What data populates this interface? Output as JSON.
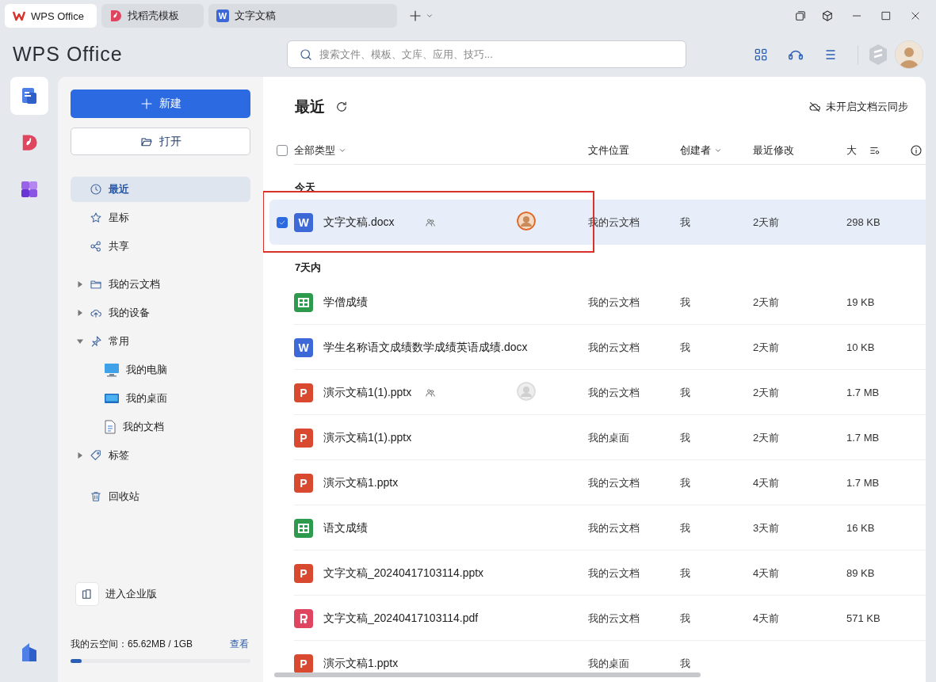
{
  "tabs": [
    {
      "label": "WPS Office",
      "kind": "wps",
      "selected": true
    },
    {
      "label": "找稻壳模板",
      "kind": "docer",
      "selected": false
    },
    {
      "label": "文字文稿",
      "kind": "word",
      "badge": "W",
      "selected": false
    }
  ],
  "header": {
    "brand": "WPS Office",
    "search": {
      "placeholder": "搜索文件、模板、文库、应用、技巧..."
    }
  },
  "rail": [
    {
      "kind": "docs",
      "selected": true
    },
    {
      "kind": "docer",
      "selected": false
    },
    {
      "kind": "apps",
      "selected": false
    }
  ],
  "sidebar": {
    "new_button": "新建",
    "open_button": "打开",
    "nav": [
      {
        "label": "最近",
        "selected": true
      },
      {
        "label": "星标",
        "selected": false
      },
      {
        "label": "共享",
        "selected": false
      }
    ],
    "tree": [
      {
        "label": "我的云文档",
        "expanded": false
      },
      {
        "label": "我的设备",
        "expanded": false
      },
      {
        "label": "常用",
        "expanded": true,
        "children": [
          {
            "label": "我的电脑"
          },
          {
            "label": "我的桌面"
          },
          {
            "label": "我的文档"
          }
        ]
      },
      {
        "label": "标签",
        "expanded": false
      }
    ],
    "trash": "回收站",
    "enterprise": "进入企业版",
    "storage": {
      "label": "我的云空间：65.62MB / 1GB",
      "link": "查看",
      "level": 0.06
    }
  },
  "main": {
    "title": "最近",
    "sync_status": "未开启文档云同步",
    "select_all": {
      "checked": false
    },
    "columns": [
      {
        "label": "全部类型",
        "dropdown": true
      },
      {
        "label": "文件位置",
        "dropdown": false
      },
      {
        "label": "创建者",
        "dropdown": true
      },
      {
        "label": "最近修改",
        "dropdown": false
      },
      {
        "label": "大",
        "dropdown": false
      }
    ],
    "groups": [
      {
        "label": "今天",
        "files": [
          {
            "name": "文字文稿.docx",
            "kind": "word",
            "badge": "W",
            "shared": true,
            "collaborator": {
              "active": true
            },
            "location": "我的云文档",
            "creator": "我",
            "modified": "2天前",
            "size": "298 KB",
            "selected": true,
            "annotated": true
          }
        ]
      },
      {
        "label": "7天内",
        "files": [
          {
            "name": "学僧成绩",
            "kind": "sheet",
            "shared": false,
            "location": "我的云文档",
            "creator": "我",
            "modified": "2天前",
            "size": "19 KB",
            "selected": false,
            "annotated": false
          },
          {
            "name": "学生名称语文成绩数学成绩英语成绩.docx",
            "kind": "word",
            "badge": "W",
            "shared": false,
            "location": "我的云文档",
            "creator": "我",
            "modified": "2天前",
            "size": "10 KB",
            "selected": false,
            "annotated": false
          },
          {
            "name": "演示文稿1(1).pptx",
            "kind": "ppt",
            "badge": "P",
            "shared": true,
            "collaborator": {
              "active": false
            },
            "location": "我的云文档",
            "creator": "我",
            "modified": "2天前",
            "size": "1.7 MB",
            "selected": false,
            "annotated": false
          },
          {
            "name": "演示文稿1(1).pptx",
            "kind": "ppt",
            "badge": "P",
            "shared": false,
            "location": "我的桌面",
            "creator": "我",
            "modified": "2天前",
            "size": "1.7 MB",
            "selected": false,
            "annotated": false
          },
          {
            "name": "演示文稿1.pptx",
            "kind": "ppt",
            "badge": "P",
            "shared": false,
            "location": "我的云文档",
            "creator": "我",
            "modified": "4天前",
            "size": "1.7 MB",
            "selected": false,
            "annotated": false
          },
          {
            "name": "语文成绩",
            "kind": "sheet",
            "shared": false,
            "location": "我的云文档",
            "creator": "我",
            "modified": "3天前",
            "size": "16 KB",
            "selected": false,
            "annotated": false
          },
          {
            "name": "文字文稿_20240417103114.pptx",
            "kind": "ppt",
            "badge": "P",
            "shared": false,
            "location": "我的云文档",
            "creator": "我",
            "modified": "4天前",
            "size": "89 KB",
            "selected": false,
            "annotated": false
          },
          {
            "name": "文字文稿_20240417103114.pdf",
            "kind": "pdf",
            "shared": false,
            "location": "我的云文档",
            "creator": "我",
            "modified": "4天前",
            "size": "571 KB",
            "selected": false,
            "annotated": false
          },
          {
            "name": "演示文稿1.pptx",
            "kind": "ppt",
            "badge": "P",
            "shared": false,
            "location": "我的桌面",
            "creator": "我",
            "selected": false,
            "annotated": false
          }
        ]
      }
    ]
  }
}
